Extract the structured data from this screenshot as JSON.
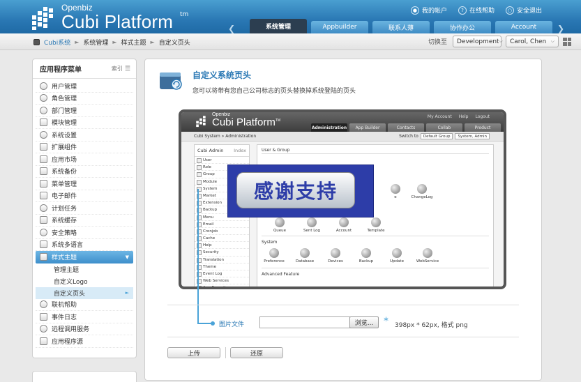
{
  "header": {
    "logo_small": "Openbiz",
    "logo_big": "Cubi Platform",
    "logo_tm": "tm",
    "links": [
      {
        "label": "我的帐户",
        "icon": "user-icon"
      },
      {
        "label": "在线帮助",
        "icon": "help-icon"
      },
      {
        "label": "安全退出",
        "icon": "logout-icon"
      }
    ],
    "tabs": [
      "系统管理",
      "Appbuilder",
      "联系人薄",
      "协作办公",
      "Account"
    ],
    "active_tab": 0
  },
  "breadcrumb": {
    "items": [
      "Cubi系统",
      "系统管理",
      "样式主题",
      "自定义页头"
    ],
    "switch_label": "切换至",
    "env_value": "Development",
    "user_value": "Carol, Chen"
  },
  "sidebar": {
    "title": "应用程序菜单",
    "index_label": "索引",
    "items": [
      "用户管理",
      "角色管理",
      "部门管理",
      "模块管理",
      "系统设置",
      "扩展组件",
      "应用市场",
      "系统备份",
      "菜单管理",
      "电子邮件",
      "计划任务",
      "系统缓存",
      "安全策略",
      "系统多语言"
    ],
    "active_item": "样式主题",
    "sub_items": [
      "管理主题",
      "自定义Logo",
      "自定义页头"
    ],
    "items_after": [
      "联机帮助",
      "事件日志",
      "远程调用服务",
      "应用程序源"
    ]
  },
  "main": {
    "title": "自定义系统页头",
    "description": "您可以将带有您自己公司标志的页头替换掉系统登陆的页头",
    "file_label": "图片文件",
    "file_value": "",
    "browse_label": "浏览...",
    "required_mark": "*",
    "hint": "398px * 62px, 格式 png",
    "upload_label": "上传",
    "restore_label": "还原"
  },
  "preview": {
    "logo_small": "Openbiz",
    "logo_big": "Cubi Platform",
    "logo_tm": "TM",
    "links": [
      "My Account",
      "Help",
      "Logout"
    ],
    "tabs": [
      "Administration",
      "App Builder",
      "Contacts",
      "Collab",
      "Product"
    ],
    "crumbs": "Cubi System  »  Administration",
    "switch_label": "Switch to",
    "switch_value1": "Default Group",
    "switch_value2": "System, Admin",
    "side_title": "Cubi Admin",
    "side_index": "Index",
    "side_items": [
      "User",
      "Role",
      "Group",
      "Module",
      "System",
      "Market",
      "Extension",
      "Backup",
      "Menu",
      "Email",
      "Cronjob",
      "Cache",
      "Help",
      "Security",
      "Translation",
      "Theme",
      "Event Log",
      "Web Services",
      "App Repository"
    ],
    "sections": [
      "User & Group",
      "System",
      "Advanced Feature"
    ],
    "icons_row2": [
      "Queue",
      "Sent Log",
      "Account",
      "Template"
    ],
    "icons_row1_label": "ChangeLog",
    "icons_row1_partial": "e",
    "icons_system": [
      "Preference",
      "Database",
      "Devices",
      "Backup",
      "Update",
      "WebService"
    ],
    "overlay_text": "感谢支持"
  },
  "colors": {
    "header_blue": "#2a78b4",
    "accent_blue": "#4aa3d8",
    "overlay_blue": "#2d3da8"
  }
}
